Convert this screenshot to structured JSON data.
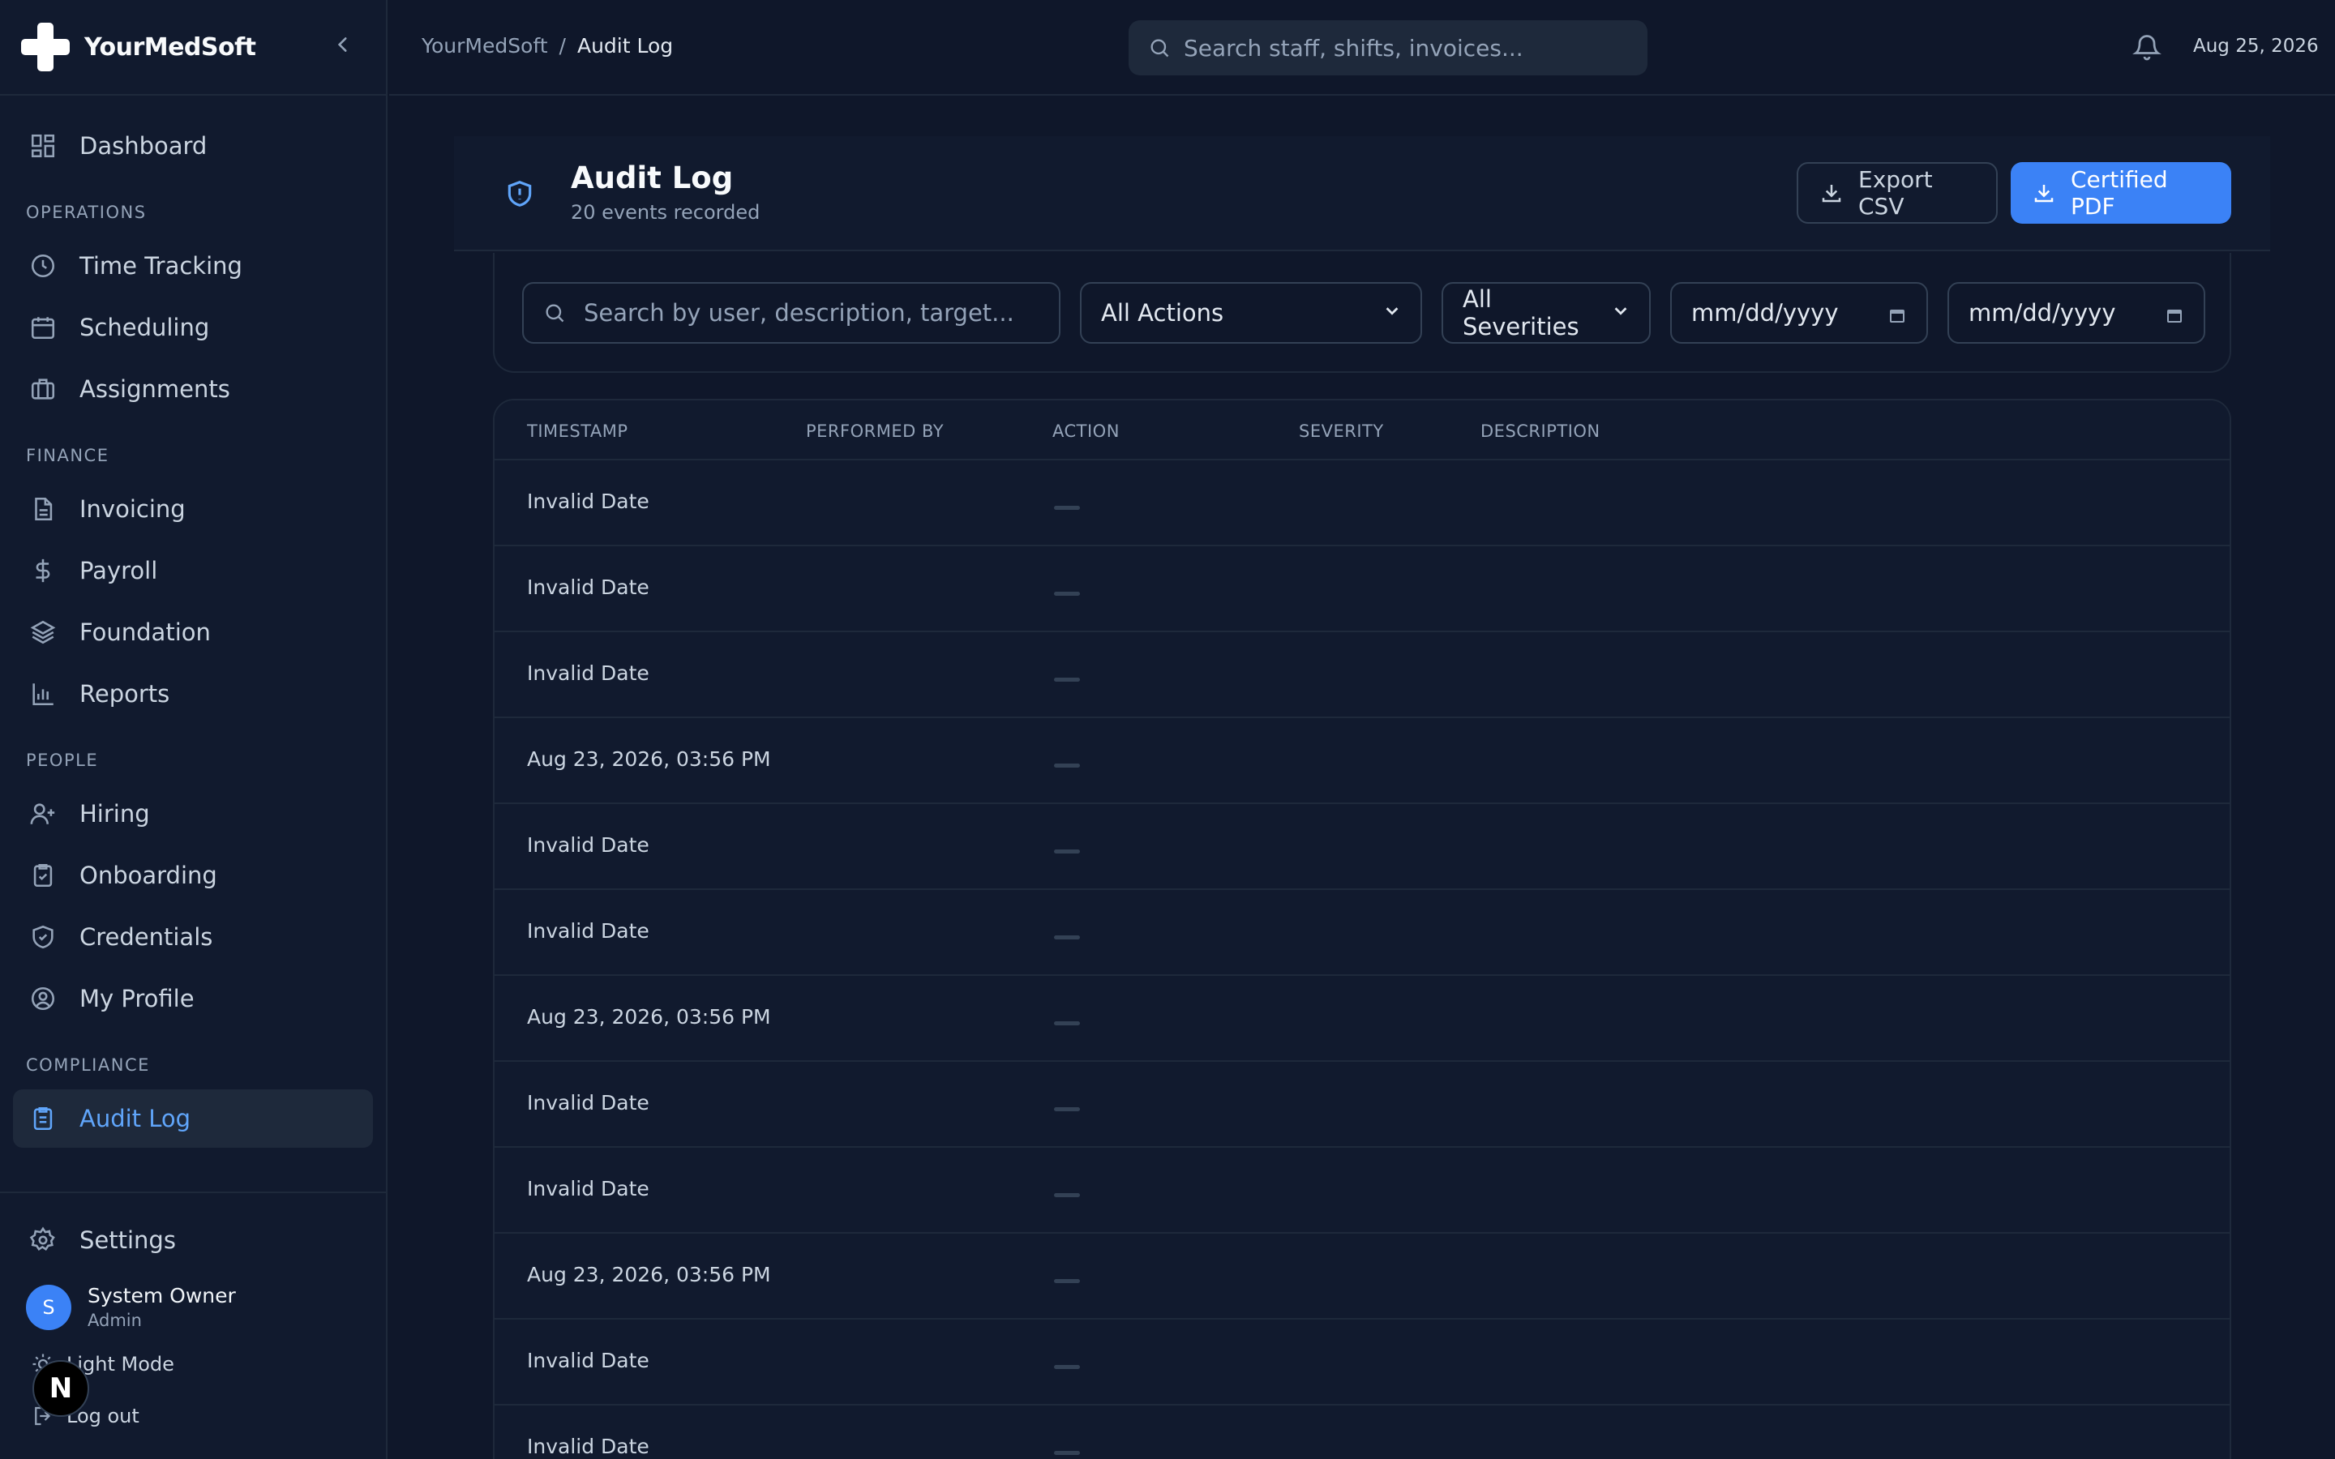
{
  "app": {
    "name": "YourMedSoft",
    "collapse_icon": "chevron-left-icon"
  },
  "sidebar": {
    "dashboard": {
      "label": "Dashboard",
      "icon": "grid-icon"
    },
    "sections": [
      {
        "title": "OPERATIONS",
        "items": [
          {
            "label": "Time Tracking",
            "icon": "clock-icon"
          },
          {
            "label": "Scheduling",
            "icon": "calendar-icon"
          },
          {
            "label": "Assignments",
            "icon": "briefcase-icon"
          }
        ]
      },
      {
        "title": "FINANCE",
        "items": [
          {
            "label": "Invoicing",
            "icon": "document-icon"
          },
          {
            "label": "Payroll",
            "icon": "dollar-icon"
          },
          {
            "label": "Foundation",
            "icon": "layers-icon"
          },
          {
            "label": "Reports",
            "icon": "bar-chart-icon"
          }
        ]
      },
      {
        "title": "PEOPLE",
        "items": [
          {
            "label": "Hiring",
            "icon": "user-plus-icon"
          },
          {
            "label": "Onboarding",
            "icon": "clipboard-check-icon"
          },
          {
            "label": "Credentials",
            "icon": "shield-check-icon"
          },
          {
            "label": "My Profile",
            "icon": "user-circle-icon"
          }
        ]
      },
      {
        "title": "COMPLIANCE",
        "items": [
          {
            "label": "Audit Log",
            "icon": "clipboard-list-icon",
            "active": true
          }
        ]
      }
    ],
    "settings": {
      "label": "Settings",
      "icon": "gear-icon"
    },
    "user": {
      "initial": "S",
      "name": "System Owner",
      "role": "Admin"
    },
    "light_mode": "Light Mode",
    "logout": "Log out",
    "dev_badge": "N"
  },
  "topbar": {
    "breadcrumb": {
      "root": "YourMedSoft",
      "separator": "/",
      "current": "Audit Log"
    },
    "search_placeholder": "Search staff, shifts, invoices...",
    "date": "Aug 25, 2026"
  },
  "page": {
    "title": "Audit Log",
    "subtitle": "20 events recorded",
    "export_csv": "Export CSV",
    "certified_pdf": "Certified PDF"
  },
  "filters": {
    "search_placeholder": "Search by user, description, target...",
    "actions_value": "All Actions",
    "severities_value": "All Severities",
    "date_from_placeholder": "mm/dd/yyyy",
    "date_to_placeholder": "mm/dd/yyyy"
  },
  "table": {
    "columns": [
      "TIMESTAMP",
      "PERFORMED BY",
      "ACTION",
      "SEVERITY",
      "DESCRIPTION"
    ],
    "rows": [
      {
        "timestamp": "Invalid Date"
      },
      {
        "timestamp": "Invalid Date"
      },
      {
        "timestamp": "Invalid Date"
      },
      {
        "timestamp": "Aug 23, 2026, 03:56 PM"
      },
      {
        "timestamp": "Invalid Date"
      },
      {
        "timestamp": "Invalid Date"
      },
      {
        "timestamp": "Aug 23, 2026, 03:56 PM"
      },
      {
        "timestamp": "Invalid Date"
      },
      {
        "timestamp": "Invalid Date"
      },
      {
        "timestamp": "Aug 23, 2026, 03:56 PM"
      },
      {
        "timestamp": "Invalid Date"
      },
      {
        "timestamp": "Invalid Date"
      }
    ]
  },
  "colors": {
    "background": "#0f172a",
    "sidebar": "#111a2e",
    "accent": "#3b82f6",
    "accent_text": "#60a5fa",
    "border": "#1e293b"
  }
}
